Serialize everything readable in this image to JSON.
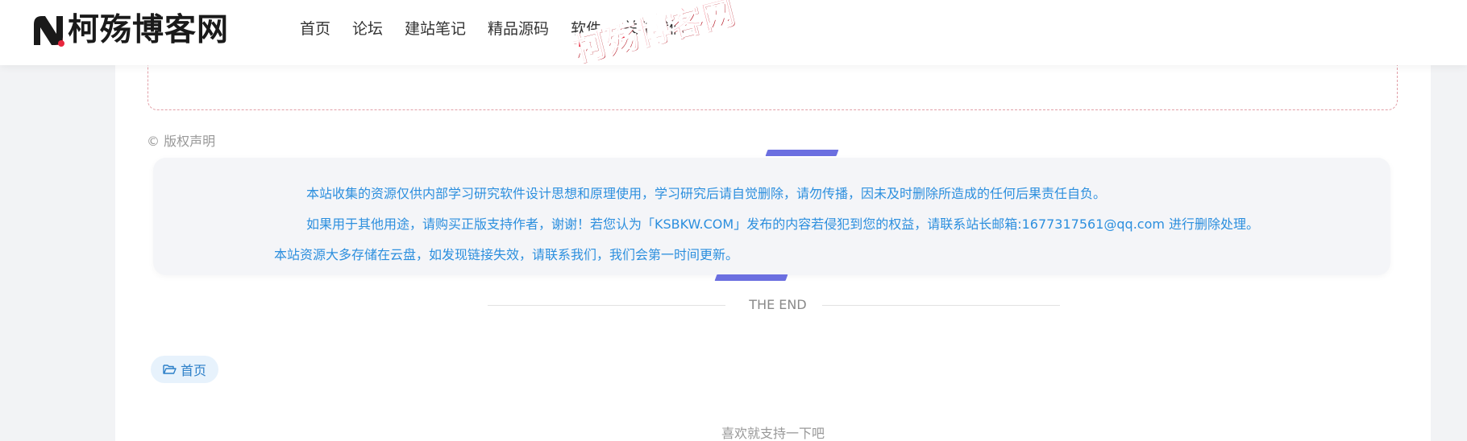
{
  "header": {
    "logo_text": "柯殇博客网",
    "nav": [
      {
        "label": "首页"
      },
      {
        "label": "论坛"
      },
      {
        "label": "建站笔记"
      },
      {
        "label": "精品源码"
      },
      {
        "label": "软件"
      },
      {
        "label": "关于我们"
      }
    ],
    "watermark": "柯殇博客网"
  },
  "article": {
    "copyright_label": "© 版权声明",
    "notice_lines": [
      "本站收集的资源仅供内部学习研究软件设计思想和原理使用，学习研究后请自觉删除，请勿传播，因未及时删除所造成的任何后果责任自负。",
      "如果用于其他用途，请购买正版支持作者，谢谢！若您认为「KSBKW.COM」发布的内容若侵犯到您的权益，请联系站长邮箱:1677317561@qq.com 进行删除处理。",
      "本站资源大多存储在云盘，如发现链接失效，请联系我们，我们会第一时间更新。"
    ],
    "the_end": "THE END",
    "category_tag": "首页",
    "support_text": "喜欢就支持一下吧"
  },
  "colors": {
    "accent_bar": "#6b6fe0",
    "notice_text": "#2c8fde",
    "watermark": "#e8273e"
  }
}
